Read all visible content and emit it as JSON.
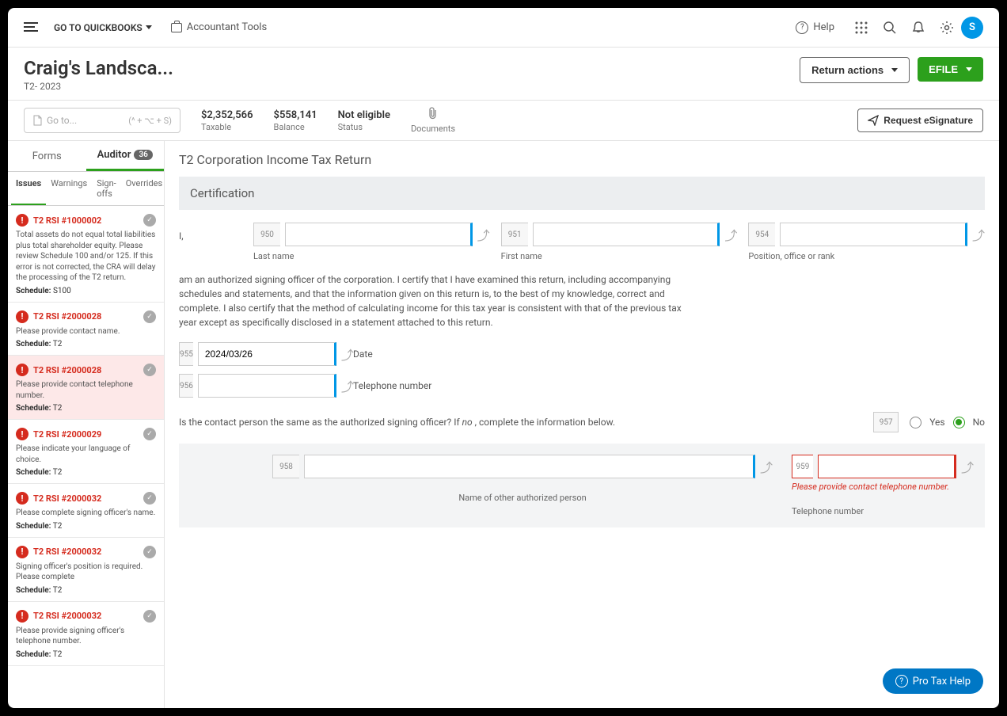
{
  "topbar": {
    "qb_link": "GO TO QUICKBOOKS",
    "tools_link": "Accountant Tools",
    "help": "Help",
    "avatar": "S"
  },
  "header": {
    "title": "Craig's Landsca...",
    "subtitle": "T2- 2023",
    "return_actions": "Return actions",
    "efile": "EFILE"
  },
  "infobar": {
    "goto_placeholder": "Go to...",
    "goto_shortcut": "(^ + ⌥ + S)",
    "taxable_val": "$2,352,566",
    "taxable_lbl": "Taxable",
    "balance_val": "$558,141",
    "balance_lbl": "Balance",
    "status_val": "Not eligible",
    "status_lbl": "Status",
    "docs_lbl": "Documents",
    "esig": "Request eSignature"
  },
  "left_tabs": {
    "forms": "Forms",
    "auditor": "Auditor",
    "count": "36"
  },
  "subtabs": {
    "issues": "Issues",
    "warnings": "Warnings",
    "signoffs": "Sign-offs",
    "overrides": "Overrides"
  },
  "issues": [
    {
      "title": "T2 RSI #1000002",
      "desc": "Total assets do not equal total liabilities plus total shareholder equity. Please review Schedule 100 and/or 125. If this error is not corrected, the CRA will delay the processing of the T2 return.",
      "sched": "S100"
    },
    {
      "title": "T2 RSI #2000028",
      "desc": "Please provide contact name.",
      "sched": "T2"
    },
    {
      "title": "T2 RSI #2000028",
      "desc": "Please provide contact telephone number.",
      "sched": "T2",
      "selected": true
    },
    {
      "title": "T2 RSI #2000029",
      "desc": "Please indicate your language of choice.",
      "sched": "T2"
    },
    {
      "title": "T2 RSI #2000032",
      "desc": "Please complete signing officer's name.",
      "sched": "T2"
    },
    {
      "title": "T2 RSI #2000032",
      "desc": "Signing officer's position is required. Please complete",
      "sched": "T2"
    },
    {
      "title": "T2 RSI #2000032",
      "desc": "Please provide signing officer's telephone number.",
      "sched": "T2"
    }
  ],
  "form": {
    "title": "T2 Corporation Income Tax Return",
    "section": "Certification",
    "i_label": "I,",
    "codes": {
      "lastname": "950",
      "firstname": "951",
      "position": "954",
      "date": "955",
      "phone": "956",
      "q": "957",
      "other_name": "958",
      "other_phone": "959"
    },
    "labels": {
      "lastname": "Last name",
      "firstname": "First name",
      "position": "Position, office or rank",
      "date": "Date",
      "phone": "Telephone number",
      "other_name": "Name of other authorized person",
      "other_phone": "Telephone number"
    },
    "cert_text": "am an authorized signing officer of the corporation. I certify that I have examined this return, including accompanying schedules and statements, and that the information given on this return is, to the best of my knowledge, correct and complete. I also certify that the method of calculating income for this tax year is consistent with that of the previous tax year except as specifically disclosed in a statement attached to this return.",
    "date_value": "2024/03/26",
    "question_pre": "Is the contact person the same as the authorized signing officer? If ",
    "question_no": "no",
    "question_post": " , complete the information below.",
    "yes": "Yes",
    "no": "No",
    "error_msg": "Please provide contact telephone number."
  },
  "help_btn": "Pro Tax Help",
  "sched_lbl": "Schedule:"
}
